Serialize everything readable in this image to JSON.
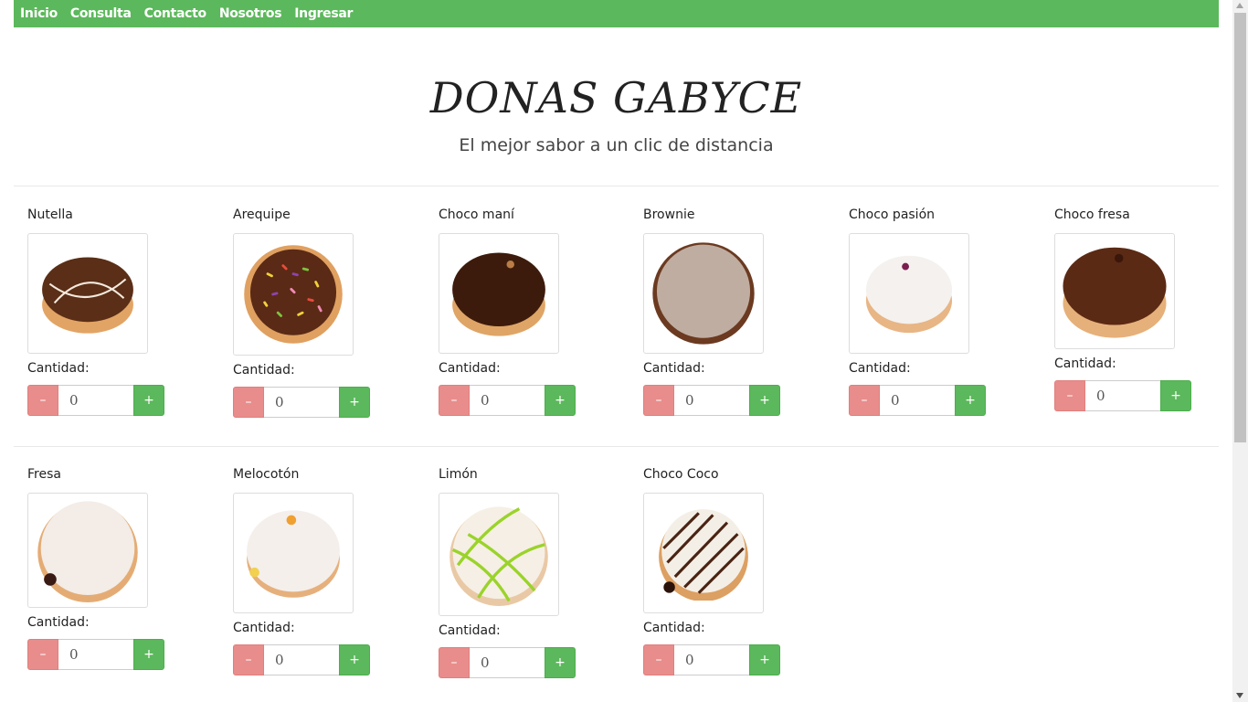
{
  "nav": {
    "items": [
      "Inicio",
      "Consulta",
      "Contacto",
      "Nosotros",
      "Ingresar"
    ]
  },
  "hero": {
    "title": "DONAS GABYCE",
    "subtitle": "El mejor sabor a un clic de distancia"
  },
  "products": [
    {
      "name": "Nutella",
      "qty_label": "Cantidad:",
      "qty": "0",
      "image": "nutella-donut-icon"
    },
    {
      "name": "Arequipe",
      "qty_label": "Cantidad:",
      "qty": "0",
      "image": "sprinkles-donut-icon"
    },
    {
      "name": "Choco maní",
      "qty_label": "Cantidad:",
      "qty": "0",
      "image": "chocolate-donut-icon"
    },
    {
      "name": "Brownie",
      "qty_label": "Cantidad:",
      "qty": "0",
      "image": "brownie-donut-icon"
    },
    {
      "name": "Choco pasión",
      "qty_label": "Cantidad:",
      "qty": "0",
      "image": "sugar-donut-icon"
    },
    {
      "name": "Choco fresa",
      "qty_label": "Cantidad:",
      "qty": "0",
      "image": "chocolate-donut-icon"
    },
    {
      "name": "Fresa",
      "qty_label": "Cantidad:",
      "qty": "0",
      "image": "sugar-donut-icon"
    },
    {
      "name": "Melocotón",
      "qty_label": "Cantidad:",
      "qty": "0",
      "image": "sugar-donut-icon"
    },
    {
      "name": "Limón",
      "qty_label": "Cantidad:",
      "qty": "0",
      "image": "lime-glazed-donut-icon"
    },
    {
      "name": "Choco Coco",
      "qty_label": "Cantidad:",
      "qty": "0",
      "image": "striped-donut-icon"
    }
  ],
  "stepper": {
    "minus": "–",
    "plus": "+"
  },
  "colors": {
    "accent": "#5cb85c",
    "minus": "#e88d8b"
  }
}
